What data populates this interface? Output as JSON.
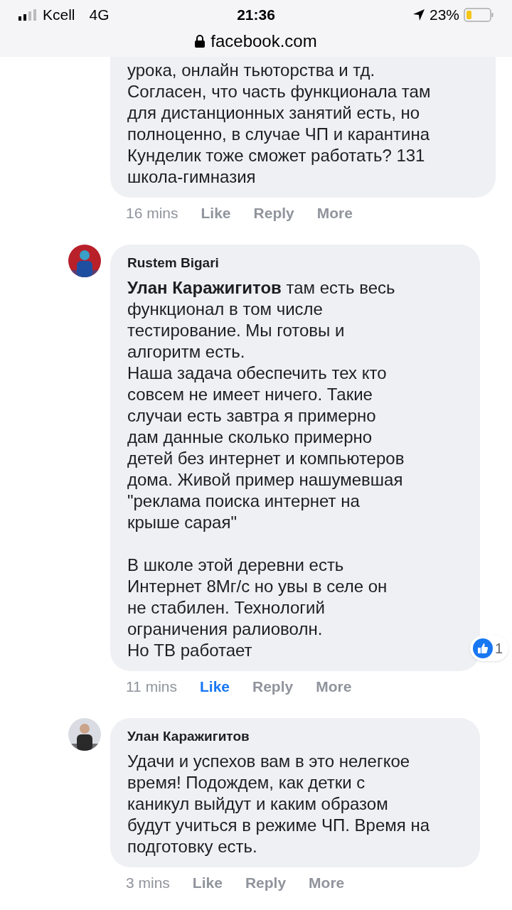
{
  "status_bar": {
    "carrier": "Kcell",
    "network": "4G",
    "time": "21:36",
    "battery": "23%",
    "url": "facebook.com"
  },
  "comments": [
    {
      "text": "урока, онлайн тьюторства и тд.\nСогласен, что часть функционала там\nдля дистанционных занятий есть, но\nполноценно, в случае ЧП и карантина\nКунделик тоже сможет работать? 131\nшкола-гимназия",
      "time": "16 mins",
      "like": "Like",
      "liked": false,
      "reply": "Reply",
      "more": "More"
    },
    {
      "author": "Rustem Bigari",
      "text": "**Улан Каражигитов** там есть весь\nфункционал в том числе\nтестирование. Мы готовы и\nалгоритм есть.\nНаша задача обеспечить тех кто\nсовсем не имеет ничего. Такие\nслучаи есть завтра я примерно\nдам данные сколько примерно\nдетей без интернет и компьютеров\nдома. Живой пример нашумевшая\n\"реклама поиска интернет на\nкрыше сарая\"\n\nВ школе этой деревни есть\nИнтернет 8Мг/с но увы в селе он\nне стабилен. Технологий\nограничения ралиоволн.\nНо ТВ работает",
      "reactions": "1",
      "time": "11 mins",
      "like": "Like",
      "liked": true,
      "reply": "Reply",
      "more": "More"
    },
    {
      "author": "Улан Каражигитов",
      "text": "Удачи и успехов вам в это нелегкое\nвремя! Подождем, как детки с\nканикул выйдут и каким образом\nбудут учиться в режиме ЧП. Время на\nподготовку есть.",
      "time": "3 mins",
      "like": "Like",
      "liked": false,
      "reply": "Reply",
      "more": "More"
    }
  ]
}
